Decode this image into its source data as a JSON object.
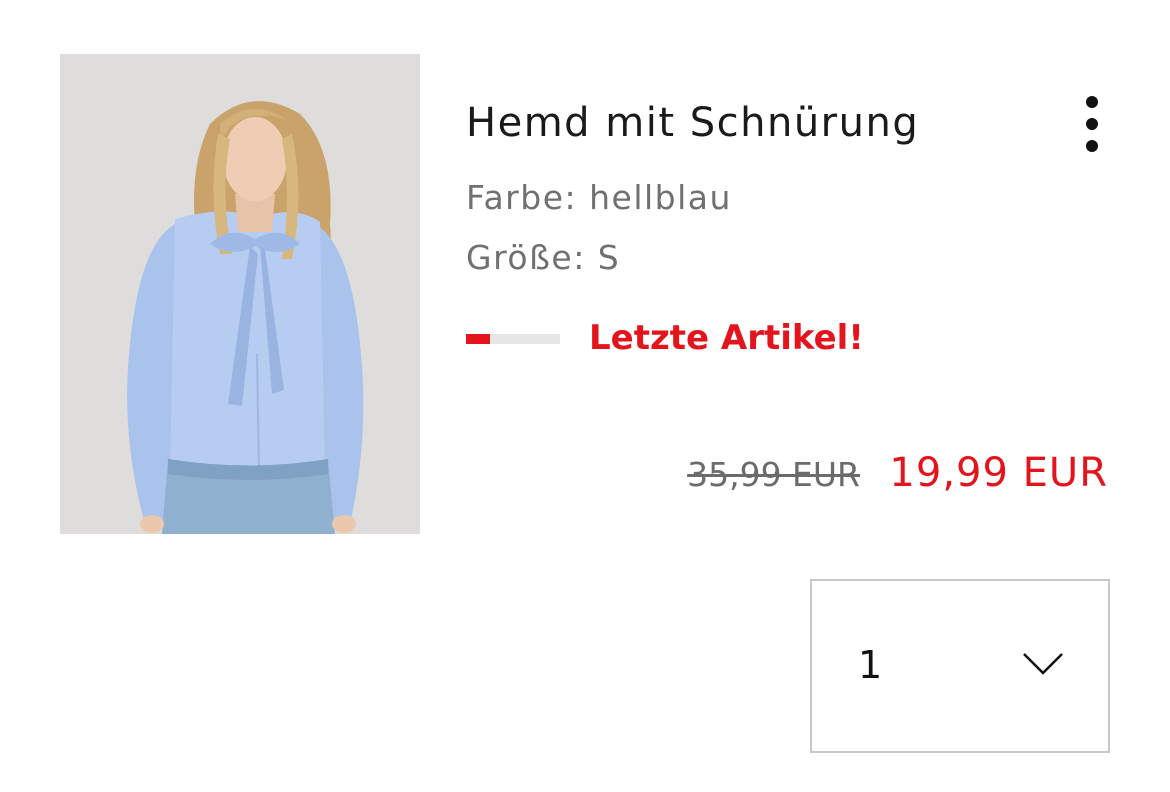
{
  "product": {
    "image_alt": "Model trägt hellblaues Hemd mit Schleife",
    "title": "Hemd mit Schnürung",
    "color_label": "Farbe: hellblau",
    "size_label": "Größe: S",
    "stock": {
      "text": "Letzte Artikel!",
      "level_percent": 25
    },
    "price_old": "35,99 EUR",
    "price_new": "19,99 EUR"
  },
  "quantity": {
    "value": "1"
  },
  "icons": {
    "more": "more-vertical-icon",
    "dropdown": "chevron-down-icon"
  },
  "colors": {
    "accent_red": "#e3141b",
    "muted_text": "#707070",
    "border": "#c8c8c8"
  }
}
